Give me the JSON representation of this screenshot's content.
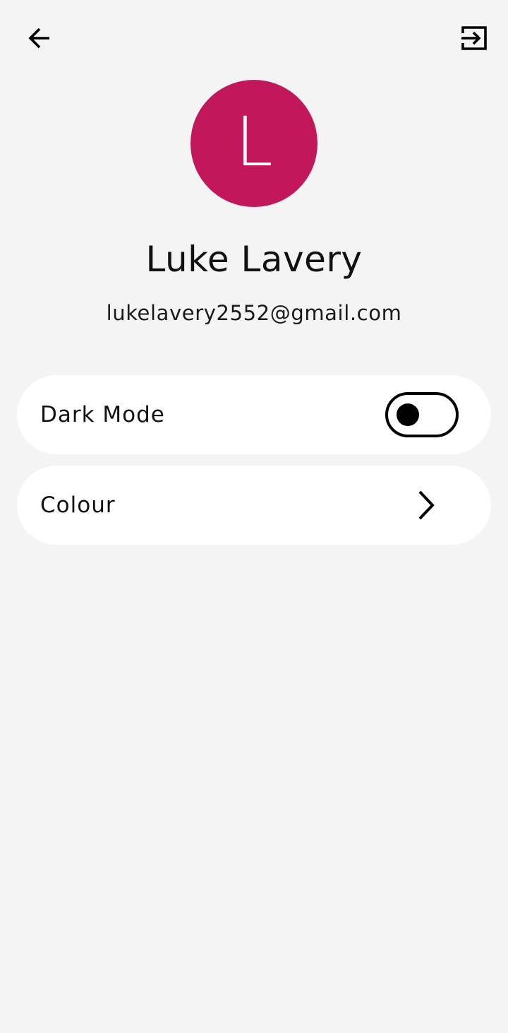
{
  "header": {
    "back_icon": "arrow-left-icon",
    "logout_icon": "logout-icon"
  },
  "profile": {
    "avatar_letter": "L",
    "avatar_color": "#c2185b",
    "name": "Luke Lavery",
    "email": "lukelavery2552@gmail.com"
  },
  "settings": {
    "dark_mode": {
      "label": "Dark Mode",
      "enabled": false
    },
    "colour": {
      "label": "Colour",
      "icon": "chevron-right-icon"
    }
  }
}
